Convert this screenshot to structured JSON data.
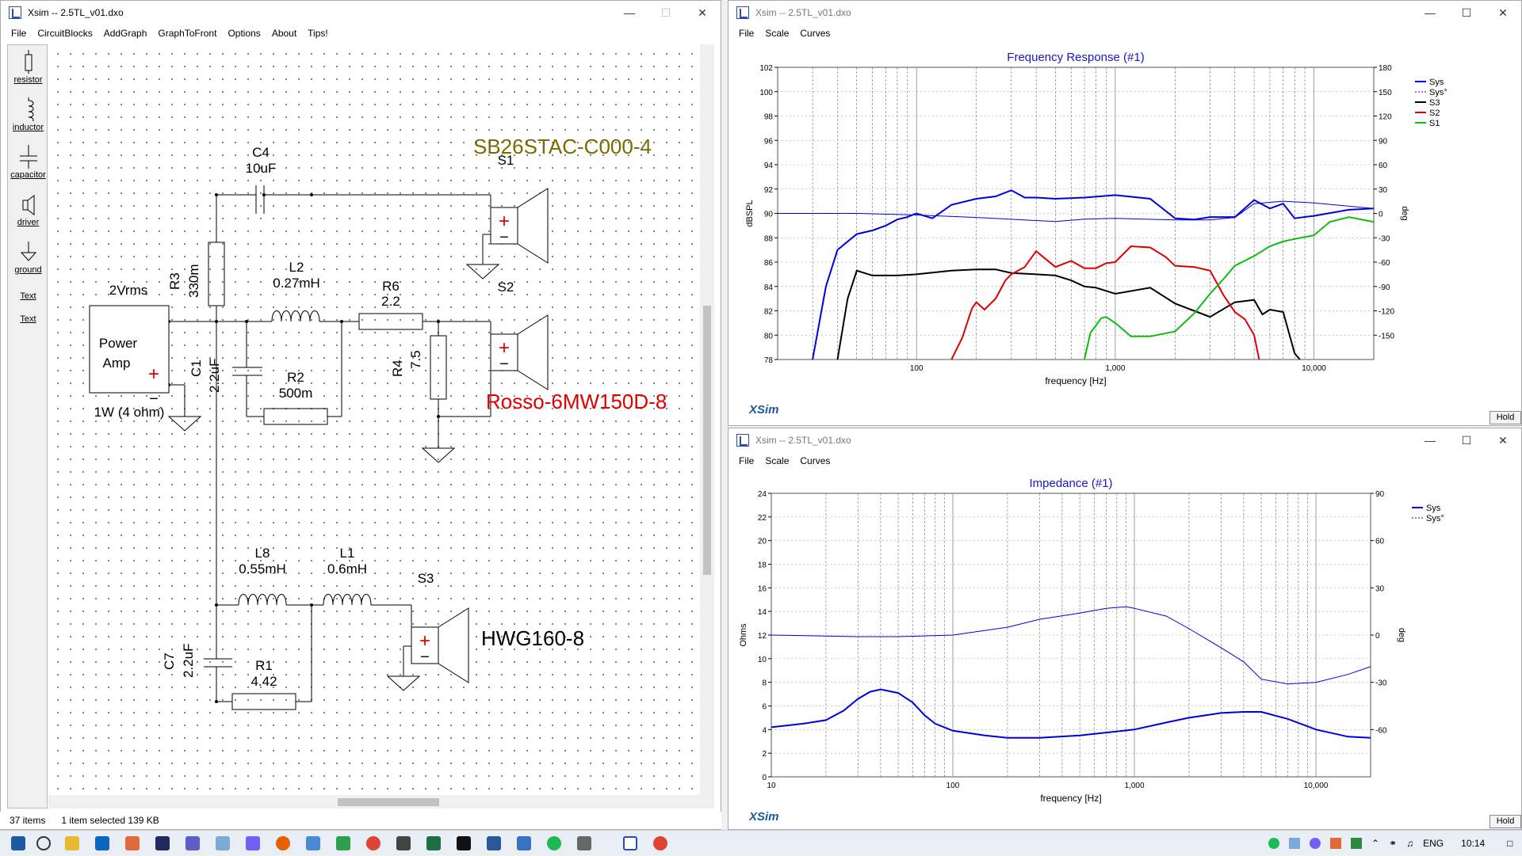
{
  "main_window": {
    "title": "Xsim -- 2.5TL_v01.dxo",
    "menu": [
      "File",
      "CircuitBlocks",
      "AddGraph",
      "GraphToFront",
      "Options",
      "About",
      "Tips!"
    ],
    "tools": [
      "resistor",
      "inductor",
      "capacitor",
      "driver",
      "ground",
      "Text",
      "Text"
    ],
    "status": {
      "items": "37 items",
      "selected": "1 item selected  139 KB"
    }
  },
  "schematic": {
    "c4_name": "C4",
    "c4_value": "10uF",
    "s1_model": "SB26STAC-C000-4",
    "s1_name": "S1",
    "r3_name": "R3",
    "r3_value": "330m",
    "l2_name": "L2",
    "l2_value": "0.27mH",
    "r6_name": "R6",
    "r6_value": "2.2",
    "s2_name": "S2",
    "amp_voltage": "2Vrms",
    "amp_label1": "Power",
    "amp_label2": "Amp",
    "amp_power": "1W (4 ohm)",
    "c1_name": "C1",
    "c1_value": "2.2uF",
    "r2_name": "R2",
    "r2_value": "500m",
    "r4_name": "R4",
    "r4_value": "7.5",
    "s2_model": "Rosso-6MW150D-8",
    "l8_name": "L8",
    "l8_value": "0.55mH",
    "l1_name": "L1",
    "l1_value": "0.6mH",
    "s3_name": "S3",
    "s3_model": "HWG160-8",
    "c7_name": "C7",
    "c7_value": "2.2uF",
    "r1_name": "R1",
    "r1_value": "4.42",
    "plus": "+",
    "minus": "−"
  },
  "fr_window": {
    "title": "Xsim -- 2.5TL_v01.dxo",
    "menu": [
      "File",
      "Scale",
      "Curves"
    ],
    "hold": "Hold",
    "brand": "XSim"
  },
  "imp_window": {
    "title": "Xsim -- 2.5TL_v01.dxo",
    "menu": [
      "File",
      "Scale",
      "Curves"
    ],
    "hold": "Hold",
    "brand": "XSim"
  },
  "colors": {
    "sys": "#0000dd",
    "s3": "#000000",
    "s2": "#e00000",
    "s1": "#10bb10",
    "grid": "#777777",
    "title": "#1717c8",
    "s1_model": "#7a6a00",
    "s2_model": "#e00000"
  },
  "chart_data": [
    {
      "type": "line",
      "title": "Frequency Response (#1)",
      "xlabel": "frequency [Hz]",
      "ylabel": "dBSPL",
      "y2label": "deg",
      "xscale": "log",
      "xlim": [
        20,
        20000
      ],
      "ylim": [
        78,
        102
      ],
      "y2lim": [
        -180,
        180
      ],
      "xticks": [
        "100",
        "1,000",
        "10,000"
      ],
      "yticks": [
        "102",
        "100",
        "98",
        "96",
        "94",
        "92",
        "90",
        "88",
        "86",
        "84",
        "82",
        "80",
        "78"
      ],
      "y2ticks": [
        "180",
        "150",
        "120",
        "90",
        "60",
        "30",
        "0",
        "-30",
        "-60",
        "-90",
        "-120",
        "-150"
      ],
      "legend": [
        "Sys",
        "Sys°",
        "S3",
        "S2",
        "S1"
      ],
      "legend_position": "top-right",
      "grid": true,
      "series": [
        {
          "name": "Sys",
          "x": [
            30,
            35,
            40,
            50,
            60,
            70,
            80,
            90,
            100,
            120,
            150,
            200,
            250,
            300,
            350,
            400,
            500,
            700,
            1000,
            1500,
            2000,
            2500,
            3000,
            4000,
            5000,
            6000,
            7000,
            8000,
            10000,
            15000,
            20000
          ],
          "y": [
            78,
            84,
            87,
            88.3,
            88.6,
            89,
            89.5,
            89.7,
            90,
            89.6,
            90.7,
            91.2,
            91.4,
            91.9,
            91.3,
            91.3,
            91.2,
            91.3,
            91.5,
            91.2,
            89.6,
            89.5,
            89.7,
            89.7,
            91.1,
            90.4,
            90.8,
            89.6,
            89.8,
            90.3,
            90.4
          ]
        },
        {
          "name": "Sys°",
          "x": [
            20,
            50,
            100,
            200,
            500,
            700,
            1000,
            2000,
            3000,
            4000,
            5000,
            7000,
            10000,
            20000
          ],
          "y2": [
            0,
            0,
            -2,
            -5,
            -10,
            -7,
            -6,
            -8,
            -8,
            -5,
            12,
            15,
            13,
            6
          ]
        },
        {
          "name": "S3",
          "x": [
            40,
            45,
            50,
            60,
            80,
            100,
            150,
            200,
            250,
            300,
            400,
            500,
            600,
            700,
            800,
            1000,
            1500,
            2000,
            3000,
            4000,
            5000,
            5500,
            6000,
            7000,
            8000,
            8500
          ],
          "y": [
            78,
            83,
            85.3,
            84.9,
            84.9,
            85,
            85.3,
            85.4,
            85.4,
            85.1,
            85,
            84.9,
            84.5,
            84,
            83.9,
            83.4,
            83.9,
            82.6,
            81.5,
            82.7,
            82.9,
            81.7,
            82.1,
            81.9,
            78.5,
            78
          ]
        },
        {
          "name": "S2",
          "x": [
            150,
            170,
            190,
            200,
            220,
            250,
            280,
            300,
            350,
            400,
            500,
            600,
            700,
            800,
            900,
            1000,
            1200,
            1500,
            1800,
            2000,
            2500,
            3000,
            3500,
            4000,
            4500,
            5000,
            5300
          ],
          "y": [
            78,
            79.8,
            82.2,
            82.7,
            82.1,
            83,
            84.5,
            85,
            85.6,
            86.9,
            85.6,
            86.1,
            85.5,
            85.5,
            85.9,
            86,
            87.3,
            87.2,
            86.4,
            85.7,
            85.6,
            85.3,
            83.3,
            81.9,
            81.3,
            80,
            78
          ]
        },
        {
          "name": "S1",
          "x": [
            700,
            750,
            800,
            850,
            900,
            1000,
            1200,
            1500,
            2000,
            2500,
            3000,
            3500,
            4000,
            5000,
            6000,
            7000,
            8000,
            10000,
            12000,
            15000,
            20000
          ],
          "y": [
            78,
            80.2,
            80.8,
            81.4,
            81.5,
            81,
            79.9,
            79.9,
            80.3,
            81.8,
            83.4,
            84.6,
            85.7,
            86.5,
            87.3,
            87.7,
            87.9,
            88.2,
            89.3,
            89.7,
            89.3
          ]
        }
      ]
    },
    {
      "type": "line",
      "title": "Impedance (#1)",
      "xlabel": "frequency [Hz]",
      "ylabel": "Ohms",
      "y2label": "deg",
      "xscale": "log",
      "xlim": [
        10,
        20000
      ],
      "ylim": [
        0,
        24
      ],
      "y2lim": [
        -90,
        90
      ],
      "xticks": [
        "10",
        "100",
        "1,000",
        "10,000"
      ],
      "yticks": [
        "24",
        "22",
        "20",
        "18",
        "16",
        "14",
        "12",
        "10",
        "8",
        "6",
        "4",
        "2",
        "0"
      ],
      "y2ticks": [
        "90",
        "60",
        "30",
        "0",
        "-30",
        "-60"
      ],
      "legend": [
        "Sys",
        "Sys°"
      ],
      "legend_position": "top-right",
      "grid": true,
      "series": [
        {
          "name": "Sys",
          "x": [
            10,
            15,
            20,
            25,
            30,
            35,
            40,
            50,
            60,
            70,
            80,
            100,
            150,
            200,
            300,
            500,
            1000,
            1500,
            2000,
            3000,
            4000,
            5000,
            7000,
            10000,
            15000,
            20000
          ],
          "y": [
            4.2,
            4.5,
            4.8,
            5.6,
            6.6,
            7.2,
            7.4,
            7.1,
            6.3,
            5.2,
            4.5,
            3.9,
            3.5,
            3.3,
            3.3,
            3.5,
            4,
            4.6,
            5,
            5.4,
            5.5,
            5.5,
            4.9,
            4,
            3.4,
            3.3
          ]
        },
        {
          "name": "Sys°",
          "x": [
            10,
            30,
            50,
            100,
            200,
            300,
            500,
            700,
            900,
            1000,
            1500,
            2000,
            3000,
            4000,
            5000,
            7000,
            10000,
            15000,
            20000
          ],
          "y2": [
            0,
            -1,
            -1,
            0,
            5,
            10,
            14,
            17,
            18,
            17,
            12,
            4,
            -8,
            -17,
            -28,
            -31,
            -30,
            -25,
            -20
          ]
        }
      ]
    }
  ]
}
